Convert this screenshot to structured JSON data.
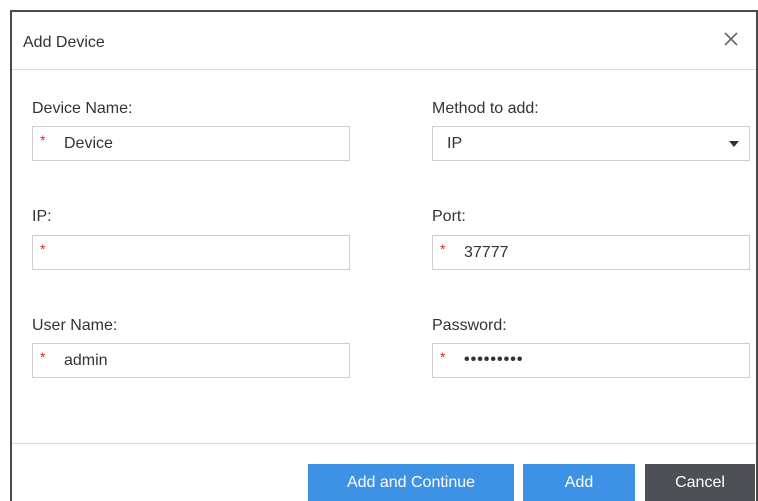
{
  "dialog": {
    "title": "Add Device",
    "close_icon": "close-icon"
  },
  "form": {
    "device_name": {
      "label": "Device Name:",
      "value": "Device",
      "required_mark": "*"
    },
    "method": {
      "label": "Method to add:",
      "value": "IP"
    },
    "ip": {
      "label": "IP:",
      "value": "",
      "required_mark": "*"
    },
    "port": {
      "label": "Port:",
      "value": "37777",
      "required_mark": "*"
    },
    "user_name": {
      "label": "User Name:",
      "value": "admin",
      "required_mark": "*"
    },
    "password": {
      "label": "Password:",
      "value": "•••••••••",
      "required_mark": "*"
    }
  },
  "buttons": {
    "add_continue": "Add and Continue",
    "add": "Add",
    "cancel": "Cancel"
  },
  "colors": {
    "primary": "#3d92e6",
    "secondary": "#4d5155",
    "required": "#e0262e"
  }
}
